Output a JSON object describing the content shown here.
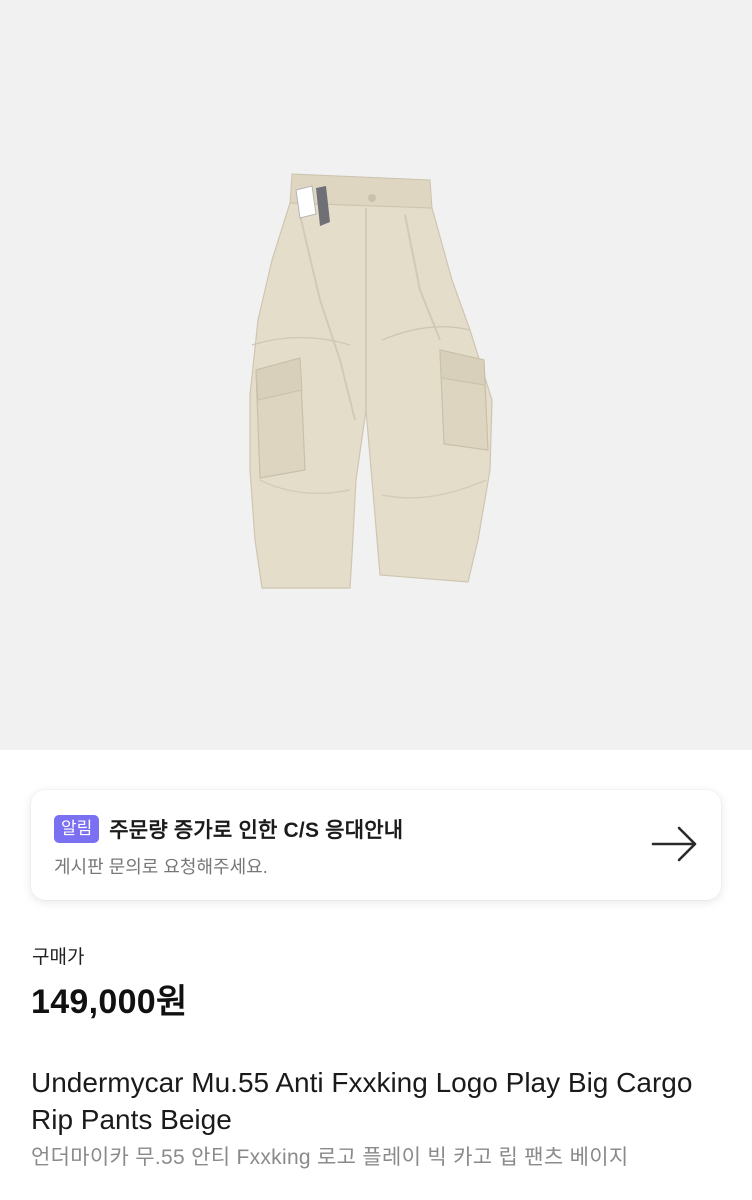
{
  "product": {
    "image_alt": "Beige cargo rip pants",
    "price_label": "구매가",
    "price": "149,000원",
    "name_en": "Undermycar Mu.55 Anti Fxxking Logo Play Big Cargo Rip Pants Beige",
    "name_ko": "언더마이카 무.55 안티 Fxxking 로고 플레이 빅 카고 립 팬츠 베이지"
  },
  "notice": {
    "badge": "알림",
    "title": "주문량 증가로 인한 C/S 응대안내",
    "subtitle": "게시판 문의로 요청해주세요.",
    "arrow_icon": "arrow-right-icon"
  },
  "colors": {
    "hero_bg": "#f2f1f2",
    "badge_bg": "#7b6ff2",
    "pants": "#e3dcc8"
  }
}
